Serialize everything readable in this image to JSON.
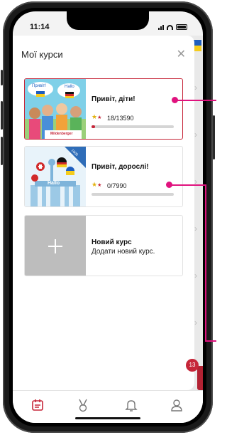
{
  "status_bar": {
    "time": "11:14"
  },
  "sheet": {
    "title": "Мої курси",
    "close_icon": "close-icon"
  },
  "courses": [
    {
      "title": "Привіт, діти!",
      "progress_text": "18/13590",
      "progress": 0.0013,
      "image_text": {
        "bubble_left": "Привіт!",
        "bubble_right": "Hallo",
        "brand": "Mildenberger"
      }
    },
    {
      "title": "Привіт, дорослі!",
      "progress_text": "0/7990",
      "progress": 0,
      "image_text": {
        "ribbon": "1000 Wörter",
        "sign": "Hallo"
      }
    }
  ],
  "new_course": {
    "title": "Новий курс",
    "subtitle": "Додати новий курс."
  },
  "background_badge": "13",
  "tabs": [
    {
      "name": "tab-courses",
      "icon": "calendar-icon",
      "active": true
    },
    {
      "name": "tab-achievements",
      "icon": "medal-icon",
      "active": false
    },
    {
      "name": "tab-notifications",
      "icon": "bell-icon",
      "active": false
    },
    {
      "name": "tab-profile",
      "icon": "user-icon",
      "active": false
    }
  ],
  "colors": {
    "accent": "#c62639",
    "callout": "#e0127e",
    "star_gold": "#e2b210"
  }
}
